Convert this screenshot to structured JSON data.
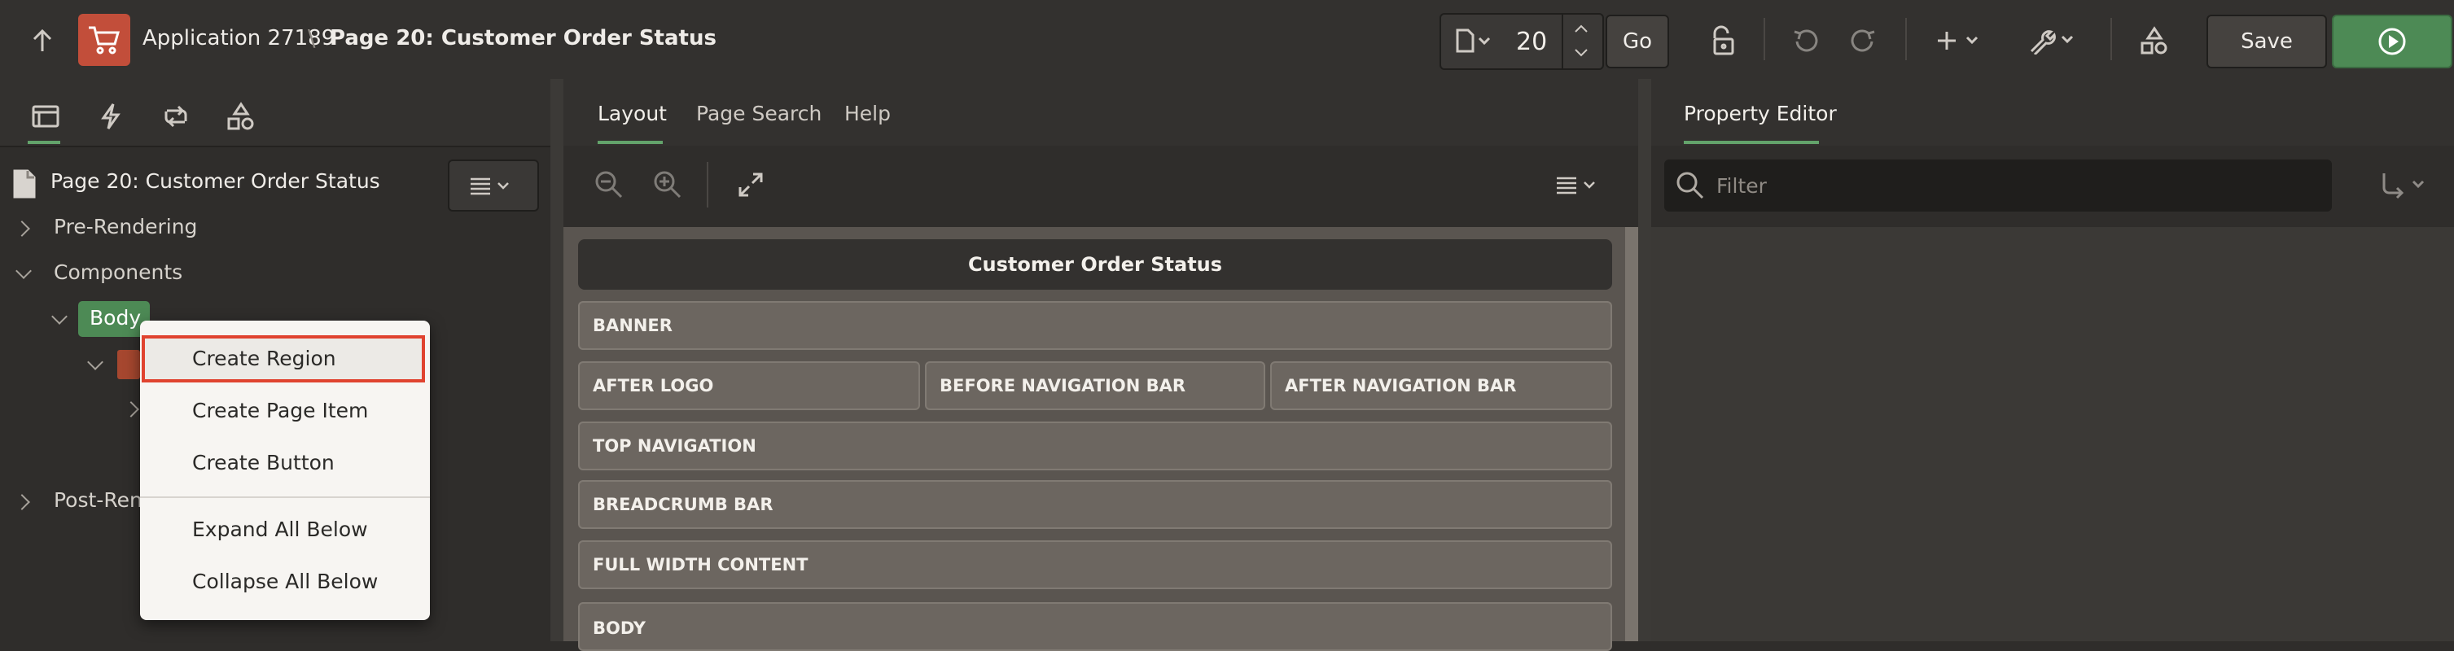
{
  "header": {
    "app_name": "Application 27189",
    "separator": "\\",
    "page_title": "Page 20: Customer Order Status",
    "page_number": "20",
    "go_label": "Go",
    "save_label": "Save"
  },
  "left_panel": {
    "page_node": "Page 20: Customer Order Status",
    "tree": {
      "pre_rendering": "Pre-Rendering",
      "components": "Components",
      "body": "Body",
      "post_rendering": "Post-Rend"
    }
  },
  "context_menu": {
    "items": [
      "Create Region",
      "Create Page Item",
      "Create Button",
      "Expand All Below",
      "Collapse All Below"
    ]
  },
  "center_panel": {
    "tabs": [
      "Layout",
      "Page Search",
      "Help"
    ],
    "page_header": "Customer Order Status",
    "regions": {
      "banner": "BANNER",
      "after_logo": "AFTER LOGO",
      "before_nav": "BEFORE NAVIGATION BAR",
      "after_nav": "AFTER NAVIGATION BAR",
      "top_nav": "TOP NAVIGATION",
      "breadcrumb": "BREADCRUMB BAR",
      "full_width": "FULL WIDTH CONTENT",
      "body": "BODY"
    }
  },
  "right_panel": {
    "tab": "Property Editor",
    "filter_placeholder": "Filter"
  },
  "colors": {
    "accent_green": "#4d8a55",
    "app_icon_red": "#c24e3a",
    "menu_highlight": "#e0432f"
  }
}
